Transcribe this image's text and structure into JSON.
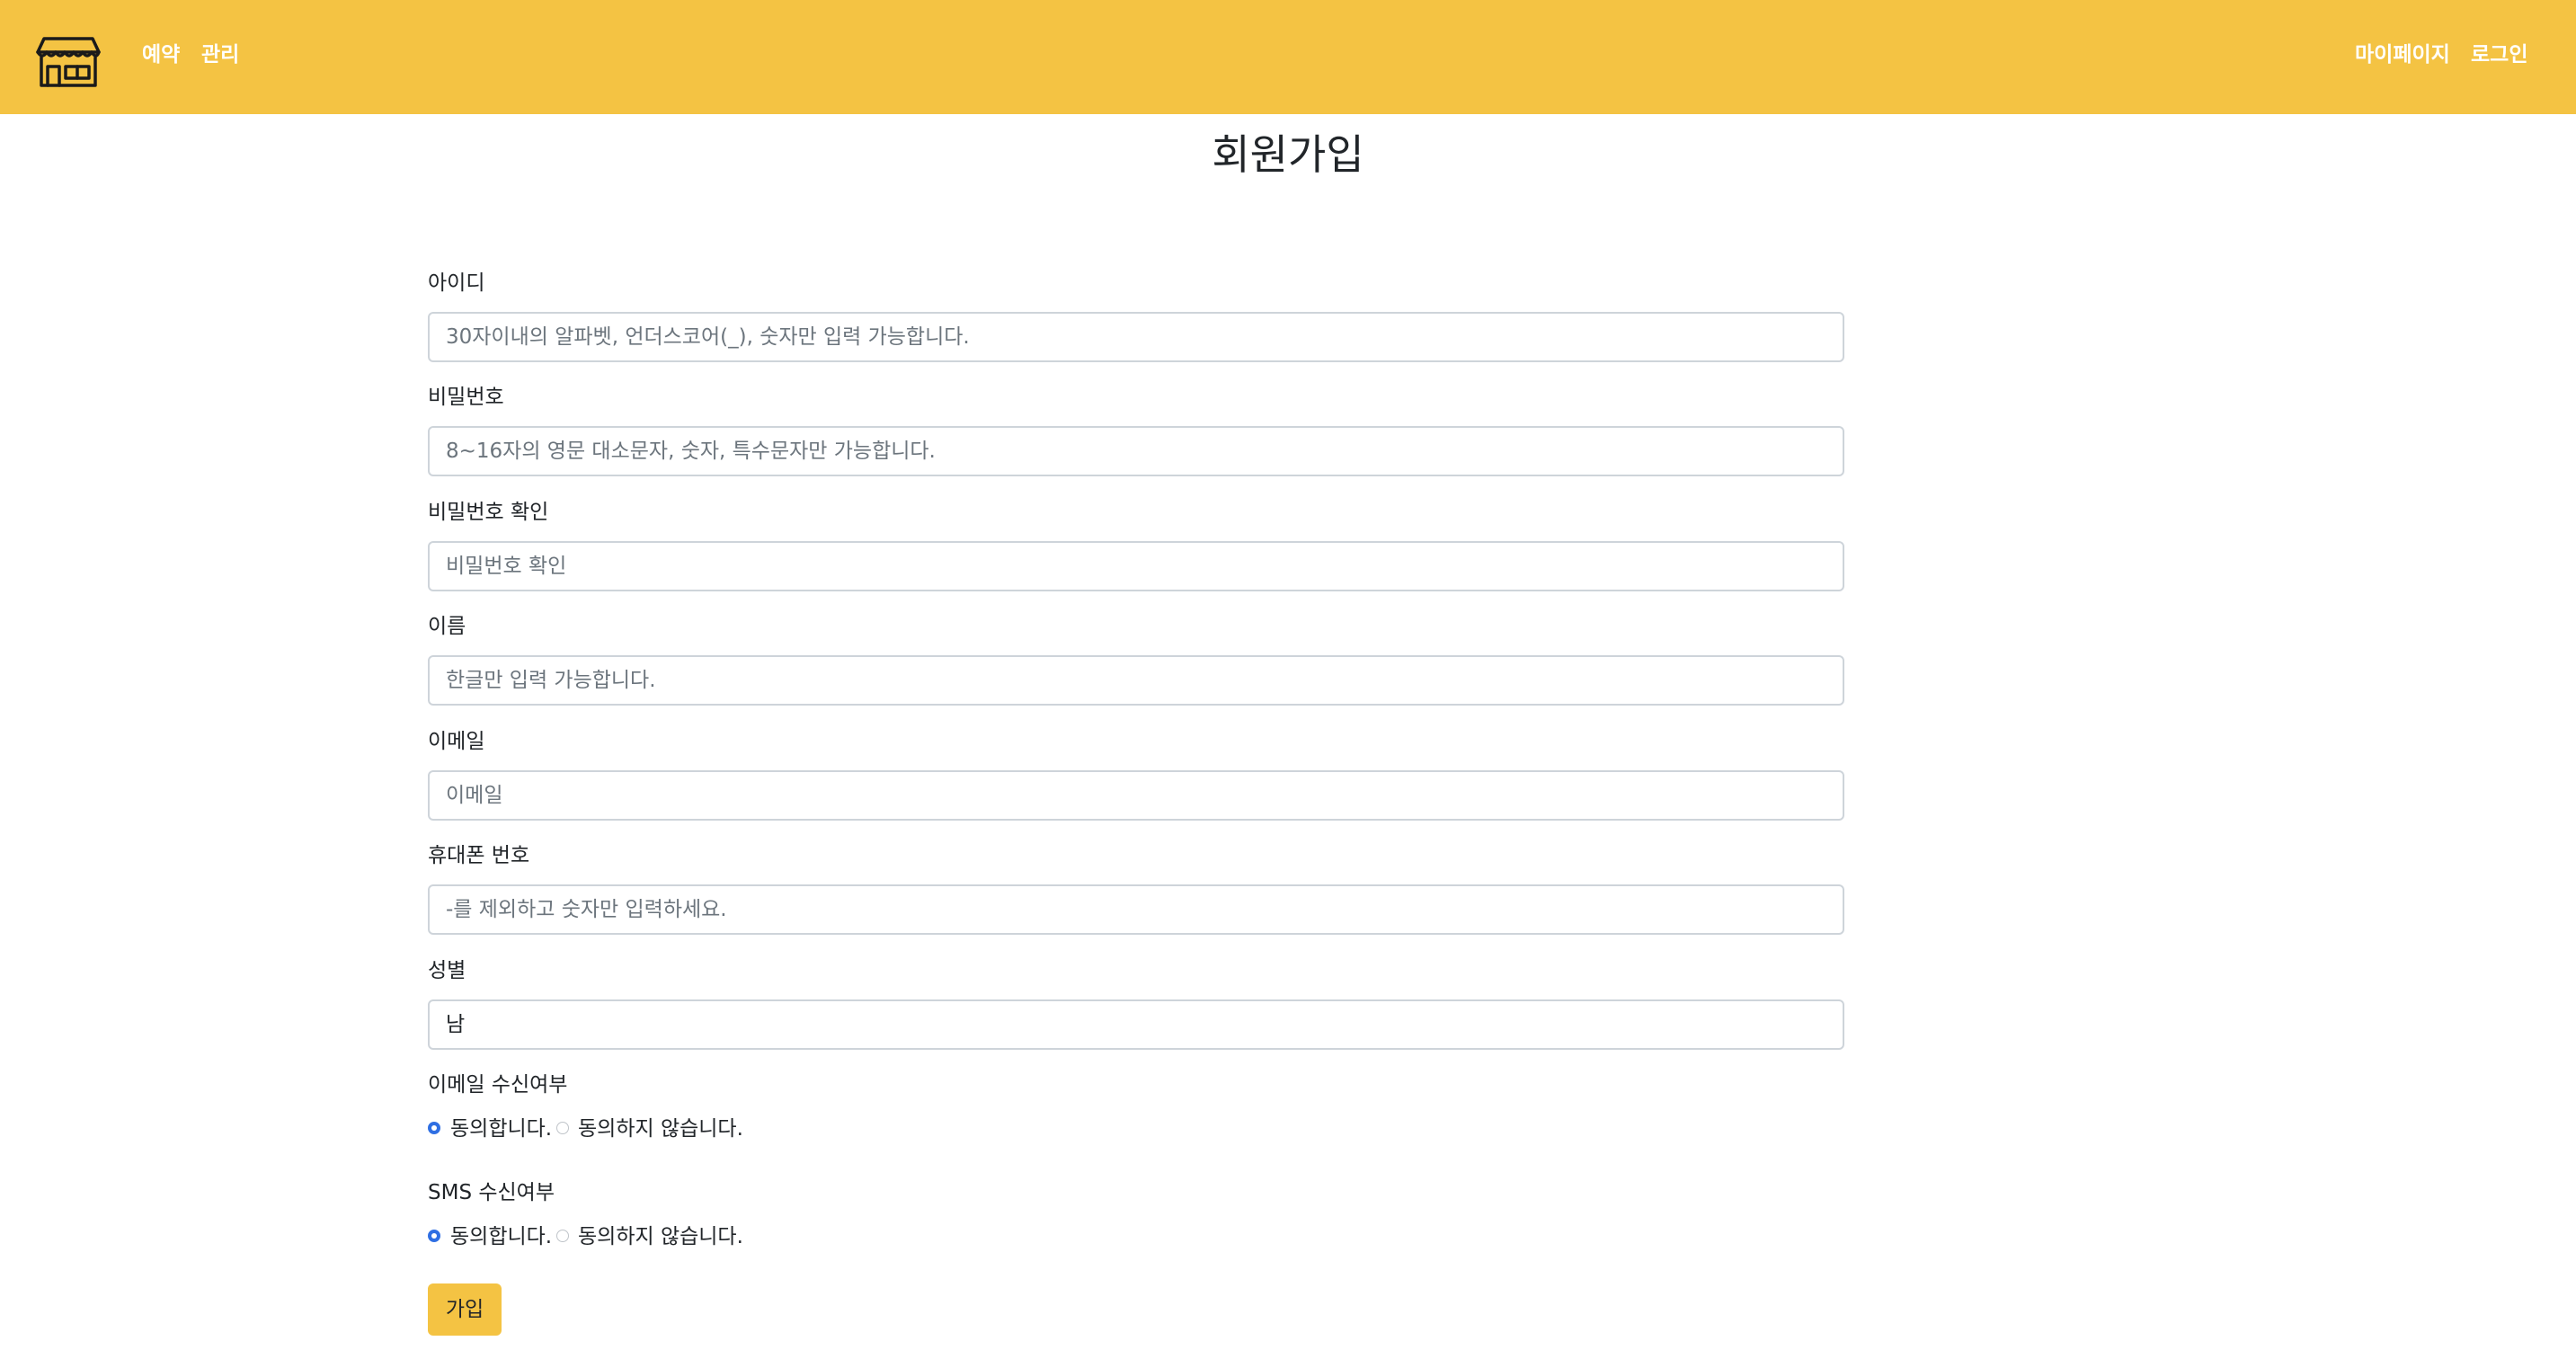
{
  "navbar": {
    "logo_icon": "storefront-icon",
    "left_links": [
      "예약",
      "관리"
    ],
    "right_links": [
      "마이페이지",
      "로그인"
    ],
    "background": "#f4c343"
  },
  "page_title": "회원가입",
  "form": {
    "username": {
      "label": "아이디",
      "placeholder": "30자이내의 알파벳, 언더스코어(_), 숫자만 입력 가능합니다."
    },
    "password": {
      "label": "비밀번호",
      "placeholder": "8~16자의 영문 대소문자, 숫자, 특수문자만 가능합니다."
    },
    "password_confirm": {
      "label": "비밀번호 확인",
      "placeholder": "비밀번호 확인"
    },
    "name": {
      "label": "이름",
      "placeholder": "한글만 입력 가능합니다."
    },
    "email": {
      "label": "이메일",
      "placeholder": "이메일"
    },
    "phone": {
      "label": "휴대폰 번호",
      "placeholder": "-를 제외하고 숫자만 입력하세요."
    },
    "gender": {
      "label": "성별",
      "value": "남"
    },
    "email_consent": {
      "label": "이메일 수신여부",
      "agree": "동의합니다.",
      "disagree": "동의하지 않습니다.",
      "selected": "agree"
    },
    "sms_consent": {
      "label": "SMS 수신여부",
      "agree": "동의합니다.",
      "disagree": "동의하지 않습니다.",
      "selected": "agree"
    },
    "submit_label": "가입"
  },
  "colors": {
    "accent": "#f4c343",
    "radio_checked": "#2f6fe3"
  }
}
